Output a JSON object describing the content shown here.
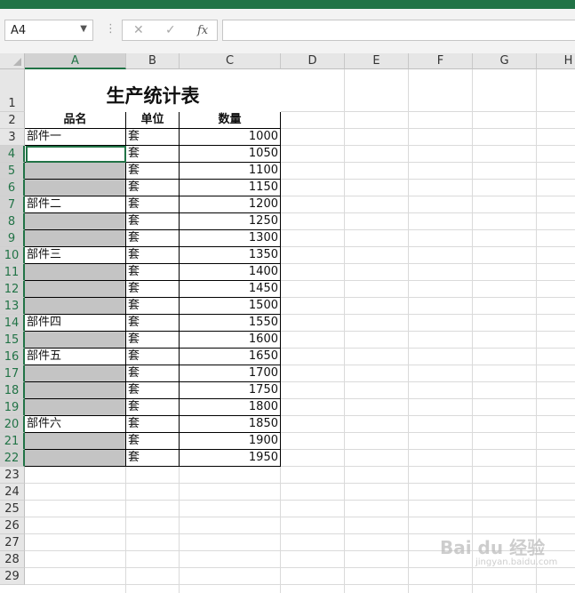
{
  "formula_bar": {
    "name_box": "A4",
    "cancel_glyph": "✕",
    "enter_glyph": "✓",
    "fx_glyph": "fx",
    "formula": ""
  },
  "columns": [
    "A",
    "B",
    "C",
    "D",
    "E",
    "F",
    "G",
    "H"
  ],
  "rows": [
    "1",
    "2",
    "3",
    "4",
    "5",
    "6",
    "7",
    "8",
    "9",
    "10",
    "11",
    "12",
    "13",
    "14",
    "15",
    "16",
    "17",
    "18",
    "19",
    "20",
    "21",
    "22",
    "23",
    "24",
    "25",
    "26",
    "27",
    "28",
    "29"
  ],
  "sheet": {
    "title": "生产统计表",
    "headers": {
      "name": "品名",
      "unit": "单位",
      "qty": "数量"
    },
    "data_rows": [
      {
        "row": 3,
        "name": "部件一",
        "unit": "套",
        "qty": "1000",
        "blank": false
      },
      {
        "row": 4,
        "name": "",
        "unit": "套",
        "qty": "1050",
        "blank": false
      },
      {
        "row": 5,
        "name": "",
        "unit": "套",
        "qty": "1100",
        "blank": true
      },
      {
        "row": 6,
        "name": "",
        "unit": "套",
        "qty": "1150",
        "blank": true
      },
      {
        "row": 7,
        "name": "部件二",
        "unit": "套",
        "qty": "1200",
        "blank": false
      },
      {
        "row": 8,
        "name": "",
        "unit": "套",
        "qty": "1250",
        "blank": true
      },
      {
        "row": 9,
        "name": "",
        "unit": "套",
        "qty": "1300",
        "blank": true
      },
      {
        "row": 10,
        "name": "部件三",
        "unit": "套",
        "qty": "1350",
        "blank": false
      },
      {
        "row": 11,
        "name": "",
        "unit": "套",
        "qty": "1400",
        "blank": true
      },
      {
        "row": 12,
        "name": "",
        "unit": "套",
        "qty": "1450",
        "blank": true
      },
      {
        "row": 13,
        "name": "",
        "unit": "套",
        "qty": "1500",
        "blank": true
      },
      {
        "row": 14,
        "name": "部件四",
        "unit": "套",
        "qty": "1550",
        "blank": false
      },
      {
        "row": 15,
        "name": "",
        "unit": "套",
        "qty": "1600",
        "blank": true
      },
      {
        "row": 16,
        "name": "部件五",
        "unit": "套",
        "qty": "1650",
        "blank": false
      },
      {
        "row": 17,
        "name": "",
        "unit": "套",
        "qty": "1700",
        "blank": true
      },
      {
        "row": 18,
        "name": "",
        "unit": "套",
        "qty": "1750",
        "blank": true
      },
      {
        "row": 19,
        "name": "",
        "unit": "套",
        "qty": "1800",
        "blank": true
      },
      {
        "row": 20,
        "name": "部件六",
        "unit": "套",
        "qty": "1850",
        "blank": false
      },
      {
        "row": 21,
        "name": "",
        "unit": "套",
        "qty": "1900",
        "blank": true
      },
      {
        "row": 22,
        "name": "",
        "unit": "套",
        "qty": "1950",
        "blank": true
      }
    ]
  },
  "selected_column": "A",
  "selected_rows": [
    4,
    22
  ],
  "watermark": {
    "main": "Bai du 经验",
    "sub": "jingyan.baidu.com"
  },
  "colors": {
    "excel_green": "#217346",
    "blank_fill": "#c4c4c4"
  }
}
